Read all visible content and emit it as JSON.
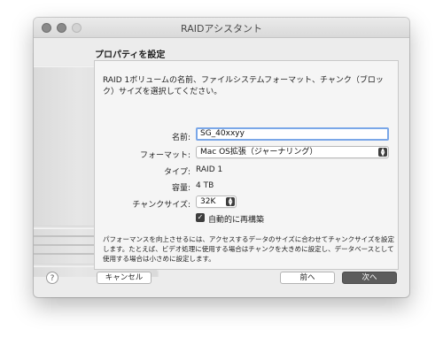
{
  "window": {
    "title": "RAIDアシスタント"
  },
  "header": {
    "label": "プロパティを設定"
  },
  "intro_text": "RAID 1ボリュームの名前、ファイルシステムフォーマット、チャンク（ブロック）サイズを選択してください。",
  "form": {
    "name_label": "名前:",
    "name_value": "SG_40xxyy",
    "format_label": "フォーマット:",
    "format_value": "Mac OS拡張（ジャーナリング）",
    "type_label": "タイプ:",
    "type_value": "RAID 1",
    "capacity_label": "容量:",
    "capacity_value": "4 TB",
    "chunk_label": "チャンクサイズ:",
    "chunk_value": "32K",
    "auto_rebuild_label": "自動的に再構築",
    "auto_rebuild_checked": true
  },
  "footnote": "パフォーマンスを向上させるには、アクセスするデータのサイズに合わせてチャンクサイズを設定します。たとえば、ビデオ処理に使用する場合はチャンクを大きめに設定し、データベースとして使用する場合は小さめに設定します。",
  "buttons": {
    "help": "?",
    "cancel": "キャンセル",
    "back": "前へ",
    "next": "次へ"
  },
  "icons": {
    "popup_arrows": "up-down-chevron",
    "checkmark": "✓"
  }
}
